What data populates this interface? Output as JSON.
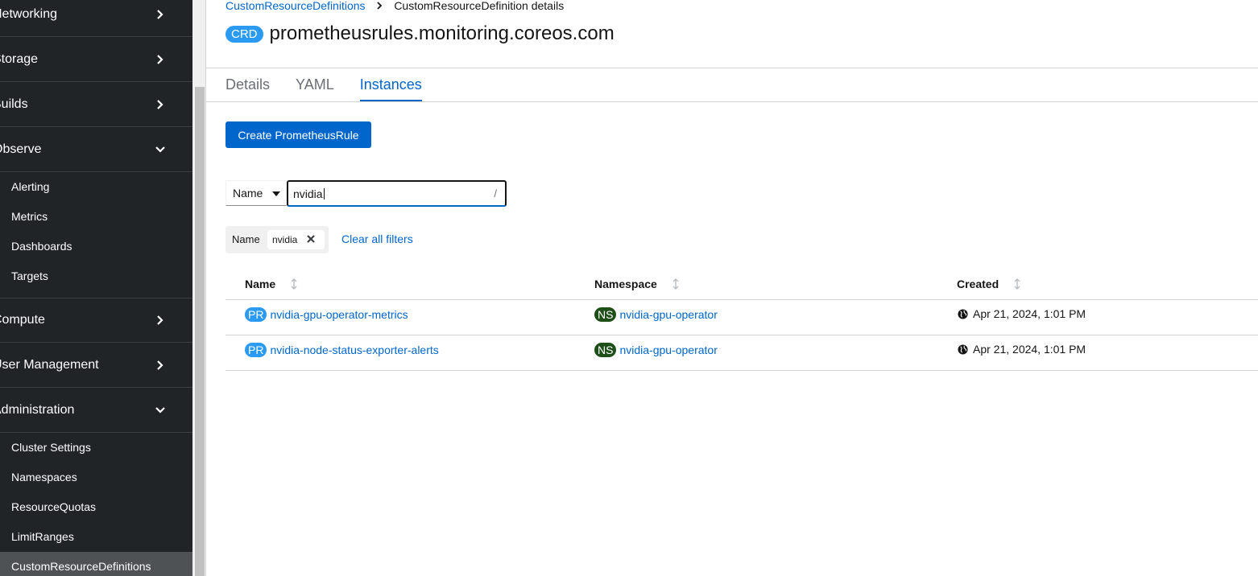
{
  "sidebar": {
    "sections": [
      {
        "label": "Networking"
      },
      {
        "label": "Storage"
      },
      {
        "label": "Builds"
      },
      {
        "label": "Observe"
      },
      {
        "label": "Compute"
      },
      {
        "label": "User Management"
      },
      {
        "label": "Administration"
      }
    ],
    "observe_items": [
      "Alerting",
      "Metrics",
      "Dashboards",
      "Targets"
    ],
    "administration_items": [
      "Cluster Settings",
      "Namespaces",
      "ResourceQuotas",
      "LimitRanges",
      "CustomResourceDefinitions"
    ]
  },
  "breadcrumb": {
    "parent": "CustomResourceDefinitions",
    "current": "CustomResourceDefinition details"
  },
  "header": {
    "badge": "CRD",
    "title": "prometheusrules.monitoring.coreos.com"
  },
  "tabs": [
    "Details",
    "YAML",
    "Instances"
  ],
  "active_tab": "Instances",
  "create_button": "Create PrometheusRule",
  "filter": {
    "type": "Name",
    "value": "nvidia",
    "shortcut": "/"
  },
  "chips": {
    "category": "Name",
    "value": "nvidia",
    "clear_all": "Clear all filters"
  },
  "table": {
    "headers": [
      "Name",
      "Namespace",
      "Created"
    ],
    "rows": [
      {
        "kind": "PR",
        "name": "nvidia-gpu-operator-metrics",
        "ns_kind": "NS",
        "namespace": "nvidia-gpu-operator",
        "created": "Apr 21, 2024, 1:01 PM"
      },
      {
        "kind": "PR",
        "name": "nvidia-node-status-exporter-alerts",
        "ns_kind": "NS",
        "namespace": "nvidia-gpu-operator",
        "created": "Apr 21, 2024, 1:01 PM"
      }
    ]
  },
  "colors": {
    "sidebar_bg": "#212427",
    "link_blue": "#0066cc",
    "badge_blue": "#2b9af3",
    "ns_green": "#1e4f18"
  }
}
